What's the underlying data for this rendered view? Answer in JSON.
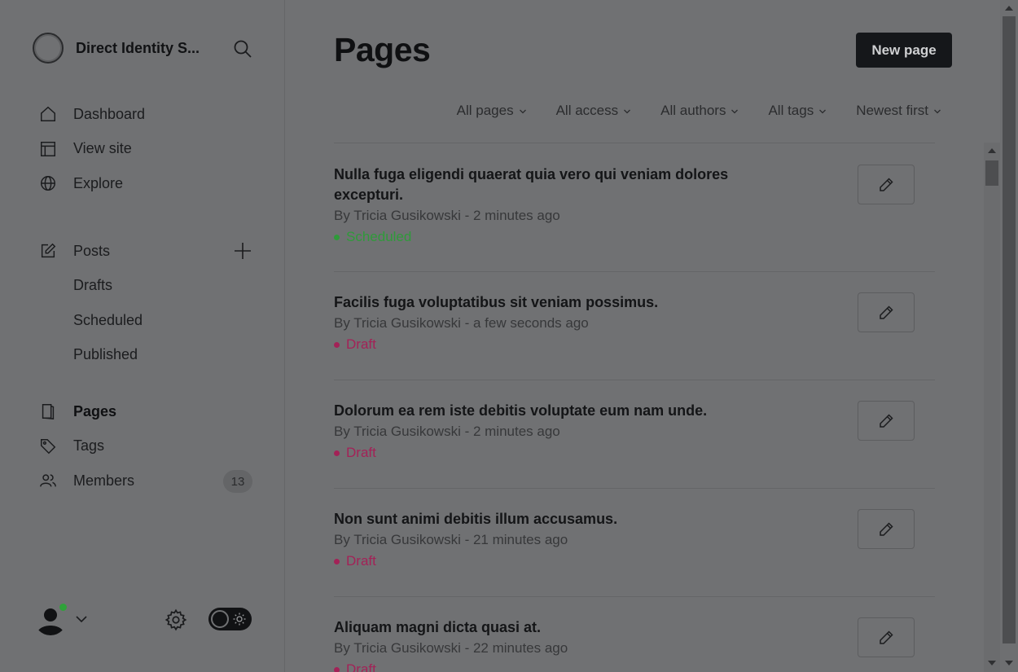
{
  "sidebar": {
    "site_name": "Direct Identity S...",
    "nav": [
      {
        "label": "Dashboard",
        "icon": "home-icon"
      },
      {
        "label": "View site",
        "icon": "layout-icon"
      },
      {
        "label": "Explore",
        "icon": "globe-icon"
      }
    ],
    "posts": {
      "label": "Posts",
      "icon": "edit-icon"
    },
    "post_filters": [
      "Drafts",
      "Scheduled",
      "Published"
    ],
    "nav2": [
      {
        "label": "Pages",
        "icon": "page-icon",
        "active": true
      },
      {
        "label": "Tags",
        "icon": "tag-icon"
      },
      {
        "label": "Members",
        "icon": "members-icon"
      }
    ],
    "members_count": "13"
  },
  "main": {
    "title": "Pages",
    "new_button": "New page",
    "filters": [
      "All pages",
      "All access",
      "All authors",
      "All tags",
      "Newest first"
    ],
    "items": [
      {
        "title": "Nulla fuga eligendi quaerat quia vero qui veniam dolores excepturi.",
        "meta": "By Tricia Gusikowski - 2 minutes ago",
        "status": "Scheduled",
        "status_color": "#2f9a3a"
      },
      {
        "title": "Facilis fuga voluptatibus sit veniam possimus.",
        "meta": "By Tricia Gusikowski - a few seconds ago",
        "status": "Draft",
        "status_color": "#a32257"
      },
      {
        "title": "Dolorum ea rem iste debitis voluptate eum nam unde.",
        "meta": "By Tricia Gusikowski - 2 minutes ago",
        "status": "Draft",
        "status_color": "#a32257"
      },
      {
        "title": "Non sunt animi debitis illum accusamus.",
        "meta": "By Tricia Gusikowski - 21 minutes ago",
        "status": "Draft",
        "status_color": "#a32257"
      },
      {
        "title": "Aliquam magni dicta quasi at.",
        "meta": "By Tricia Gusikowski - 22 minutes ago",
        "status": "Draft",
        "status_color": "#a32257"
      }
    ]
  }
}
